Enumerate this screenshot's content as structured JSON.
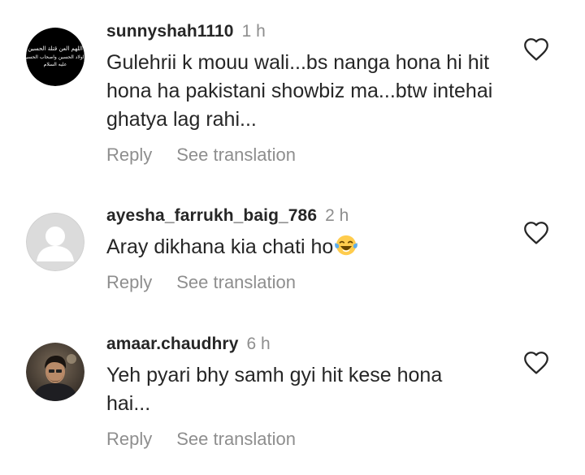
{
  "comments": [
    {
      "username": "sunnyshah1110",
      "time": "1 h",
      "text": "Gulehrii k mouu wali...bs nanga hona hi hit hona ha pakistani showbiz ma...btw intehai ghatya lag rahi...",
      "avatar_text": "اللهم العن قتلة الحسين و اولاد الحسين واصحاب الحسين عليه السلام",
      "reply_label": "Reply",
      "translate_label": "See translation"
    },
    {
      "username": "ayesha_farrukh_baig_786",
      "time": "2 h",
      "text": "Aray dikhana kia chati ho",
      "emoji": "face-with-tears-of-joy",
      "reply_label": "Reply",
      "translate_label": "See translation"
    },
    {
      "username": "amaar.chaudhry",
      "time": "6 h",
      "text": "Yeh pyari bhy samh gyi hit kese hona hai...",
      "reply_label": "Reply",
      "translate_label": "See translation"
    }
  ],
  "colors": {
    "text": "#262626",
    "secondary": "#8e8e8e",
    "avatar_placeholder": "#dbdbdb"
  }
}
